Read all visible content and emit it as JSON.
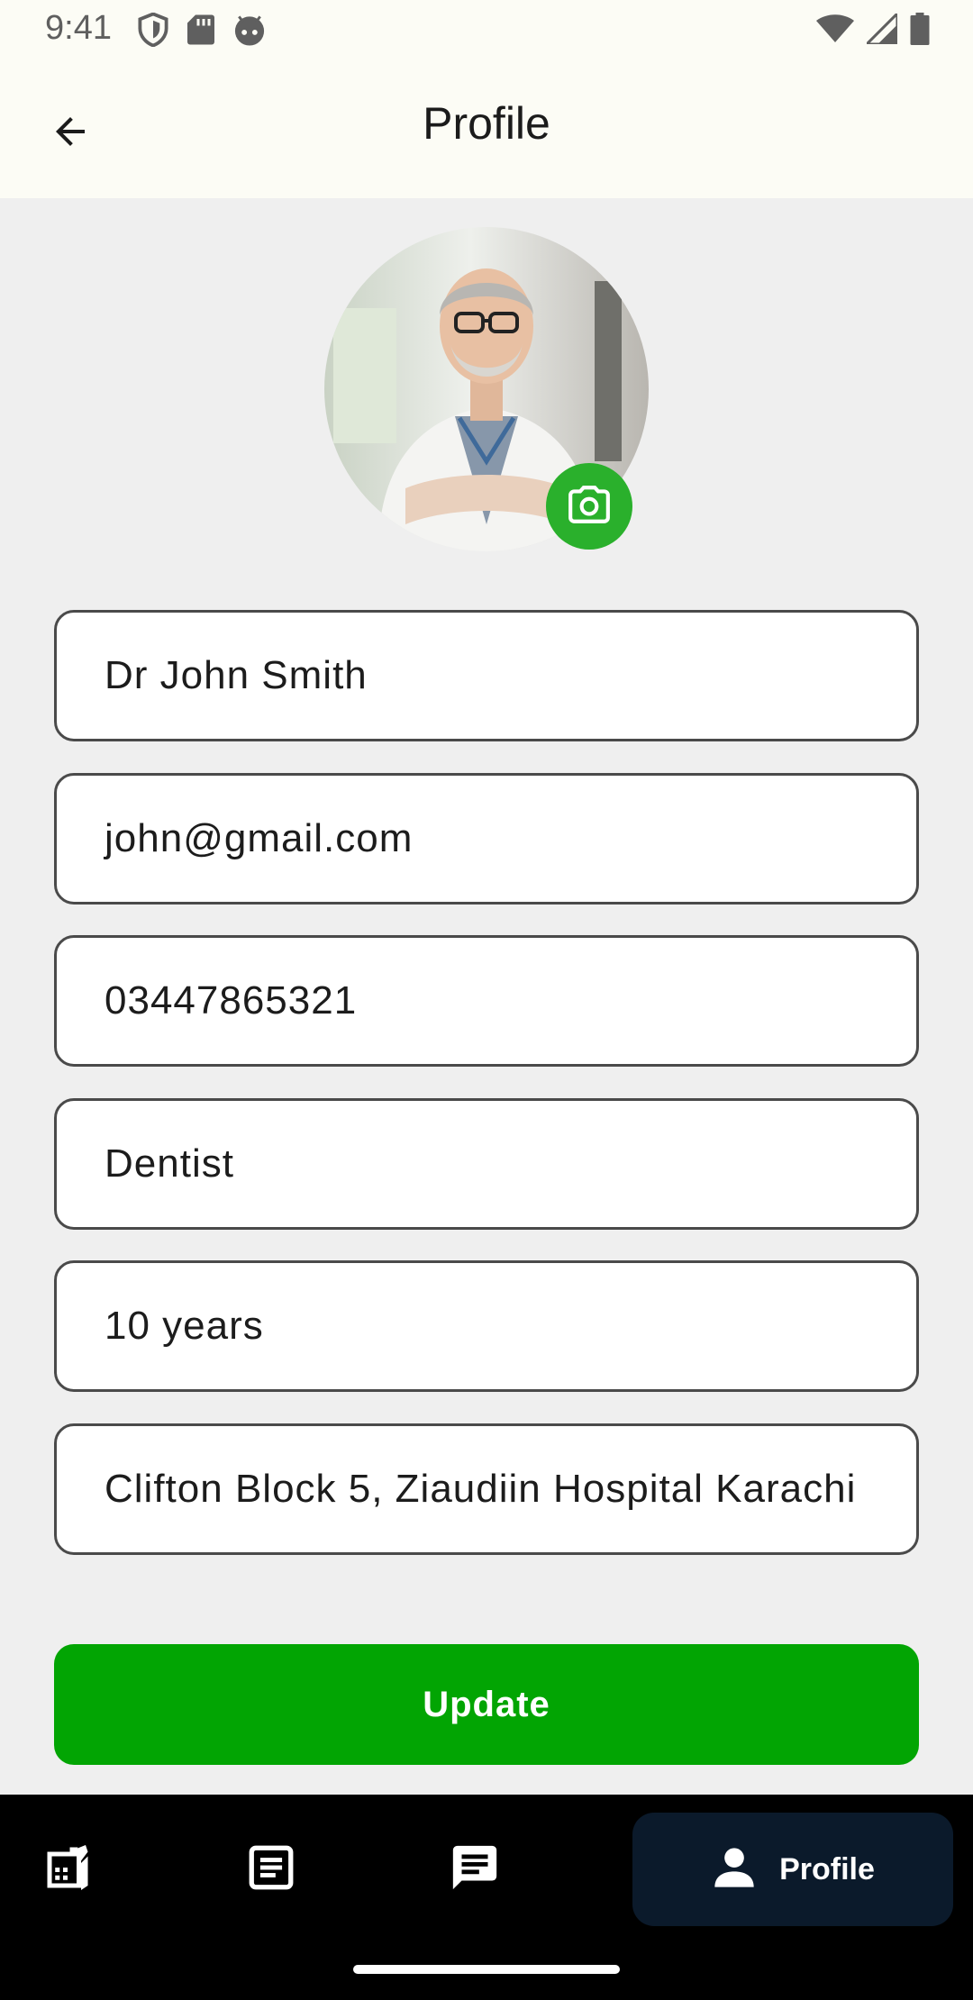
{
  "status_bar": {
    "time": "9:41",
    "left_icons": [
      "shield-icon",
      "sd-card-icon",
      "android-face-icon"
    ],
    "right_icons": [
      "wifi-icon",
      "cellular-signal-icon",
      "battery-icon"
    ]
  },
  "app_bar": {
    "back_icon": "arrow-back-icon",
    "title": "Profile"
  },
  "avatar": {
    "edit_icon": "camera-icon",
    "edit_button_color": "#2ab02c"
  },
  "form": {
    "name": "Dr John Smith",
    "email": "john@gmail.com",
    "phone": "03447865321",
    "specialty": "Dentist",
    "experience": "10 years",
    "address": "Clifton Block 5, Ziaudiin Hospital Karachi"
  },
  "actions": {
    "update_label": "Update",
    "update_color": "#02a503"
  },
  "bottom_nav": {
    "items": [
      {
        "icon": "calendar-edit-icon",
        "label": "",
        "active": false
      },
      {
        "icon": "article-icon",
        "label": "",
        "active": false
      },
      {
        "icon": "chat-icon",
        "label": "",
        "active": false
      },
      {
        "icon": "person-icon",
        "label": "Profile",
        "active": true
      }
    ],
    "active_background": "#0b1a2b"
  },
  "colors": {
    "topbar": "#fcfcf5",
    "background": "#efefef",
    "field_border": "#4a4a4a",
    "nav_background": "#000000"
  }
}
